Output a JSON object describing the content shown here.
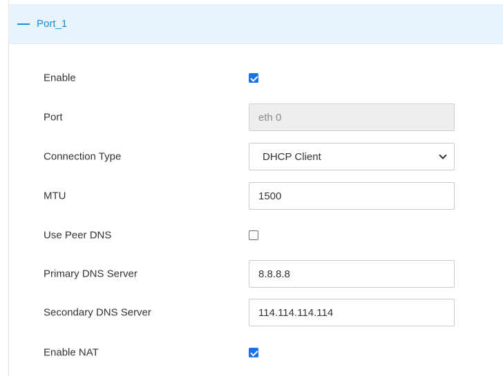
{
  "section": {
    "title": "Port_1"
  },
  "fields": {
    "enable": {
      "label": "Enable",
      "checked": true
    },
    "port": {
      "label": "Port",
      "value": "eth 0"
    },
    "connection_type": {
      "label": "Connection Type",
      "value": "DHCP Client"
    },
    "mtu": {
      "label": "MTU",
      "value": "1500"
    },
    "use_peer_dns": {
      "label": "Use Peer DNS",
      "checked": false
    },
    "primary_dns": {
      "label": "Primary DNS Server",
      "value": "8.8.8.8"
    },
    "secondary_dns": {
      "label": "Secondary DNS Server",
      "value": "114.114.114.114"
    },
    "enable_nat": {
      "label": "Enable NAT",
      "checked": true
    }
  },
  "colors": {
    "accent": "#1e8ad3",
    "header_bg": "#e7f4fc",
    "checkbox": "#1a73e8"
  }
}
